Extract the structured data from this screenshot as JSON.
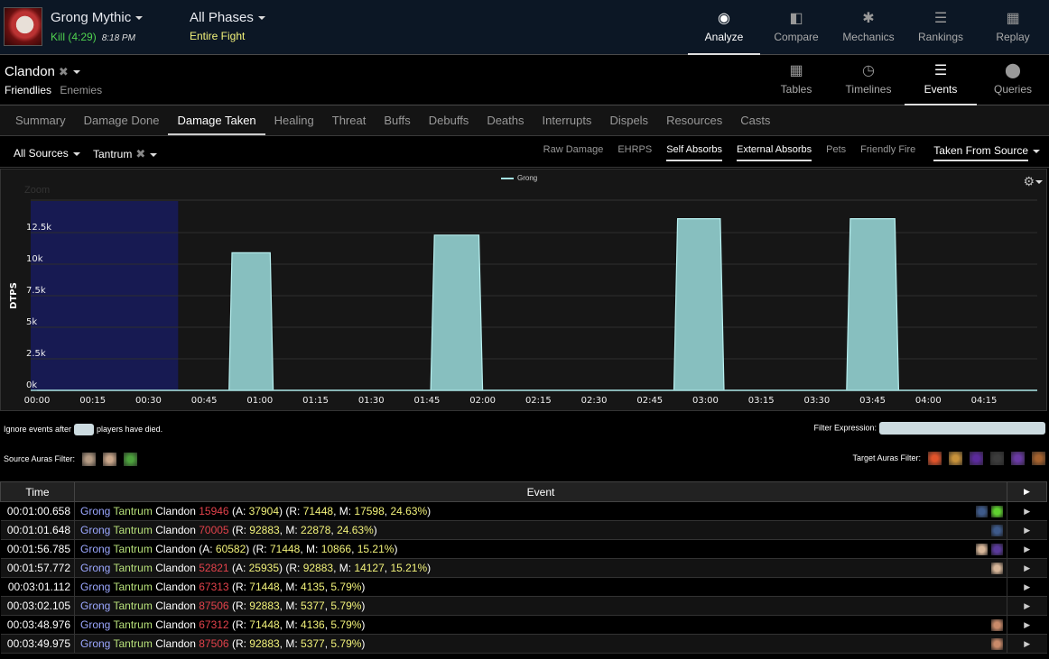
{
  "header": {
    "fight_name": "Grong Mythic",
    "kill_label": "Kill (4:29)",
    "fight_time": "8:18 PM",
    "phase_name": "All Phases",
    "phase_sub": "Entire Fight",
    "nav": [
      {
        "label": "Analyze",
        "icon": "eye-icon",
        "active": true
      },
      {
        "label": "Compare",
        "icon": "compare-icon",
        "active": false
      },
      {
        "label": "Mechanics",
        "icon": "puzzle-icon",
        "active": false
      },
      {
        "label": "Rankings",
        "icon": "sort-icon",
        "active": false
      },
      {
        "label": "Replay",
        "icon": "film-icon",
        "active": false
      }
    ]
  },
  "actor": {
    "name": "Clandon",
    "friendlies_label": "Friendlies",
    "enemies_label": "Enemies",
    "views": [
      {
        "label": "Tables",
        "icon": "grid-icon",
        "active": false
      },
      {
        "label": "Timelines",
        "icon": "clock-icon",
        "active": false
      },
      {
        "label": "Events",
        "icon": "list-icon",
        "active": true
      },
      {
        "label": "Queries",
        "icon": "map-pin-icon",
        "active": false
      }
    ]
  },
  "tabs": [
    {
      "label": "Summary",
      "active": false
    },
    {
      "label": "Damage Done",
      "active": false
    },
    {
      "label": "Damage Taken",
      "active": true
    },
    {
      "label": "Healing",
      "active": false
    },
    {
      "label": "Threat",
      "active": false
    },
    {
      "label": "Buffs",
      "active": false
    },
    {
      "label": "Debuffs",
      "active": false
    },
    {
      "label": "Deaths",
      "active": false
    },
    {
      "label": "Interrupts",
      "active": false
    },
    {
      "label": "Dispels",
      "active": false
    },
    {
      "label": "Resources",
      "active": false
    },
    {
      "label": "Casts",
      "active": false
    }
  ],
  "filters": {
    "source": "All Sources",
    "ability": "Tantrum",
    "options": [
      {
        "label": "Raw Damage",
        "on": false
      },
      {
        "label": "EHRPS",
        "on": false
      },
      {
        "label": "Self Absorbs",
        "on": true
      },
      {
        "label": "External Absorbs",
        "on": true
      },
      {
        "label": "Pets",
        "on": false
      },
      {
        "label": "Friendly Fire",
        "on": false
      }
    ],
    "taken_from": "Taken From Source"
  },
  "chart_data": {
    "type": "area",
    "title": "",
    "zoom_label": "Zoom",
    "ylabel": "DTPS",
    "xlabel": "",
    "legend": [
      "Grong"
    ],
    "legend_position": "top-center",
    "grid": true,
    "ylim": [
      0,
      15000
    ],
    "xlim_seconds": [
      0,
      265
    ],
    "yticks": [
      "0k",
      "2.5k",
      "5k",
      "7.5k",
      "10k",
      "12.5k"
    ],
    "ytick_values": [
      0,
      2500,
      5000,
      7500,
      10000,
      12500
    ],
    "xticks": [
      "00:00",
      "00:15",
      "00:30",
      "00:45",
      "01:00",
      "01:15",
      "01:30",
      "01:45",
      "02:00",
      "02:15",
      "02:30",
      "02:45",
      "03:00",
      "03:15",
      "03:30",
      "03:45",
      "04:00",
      "04:15"
    ],
    "zoom_region_seconds": [
      0,
      38
    ],
    "color": "#87bfbf",
    "series": [
      {
        "name": "Grong",
        "points_seconds_value": [
          [
            0,
            0
          ],
          [
            51.7,
            0
          ],
          [
            52.5,
            10900
          ],
          [
            62.8,
            10900
          ],
          [
            63.6,
            0
          ],
          [
            106,
            0
          ],
          [
            107,
            12300
          ],
          [
            119,
            12300
          ],
          [
            120,
            0
          ],
          [
            171.5,
            0
          ],
          [
            172.5,
            13600
          ],
          [
            184,
            13600
          ],
          [
            185,
            0
          ],
          [
            218,
            0
          ],
          [
            219,
            13600
          ],
          [
            231,
            13600
          ],
          [
            232,
            0
          ],
          [
            265,
            0
          ]
        ]
      }
    ]
  },
  "options_row": {
    "ignore_prefix": "Ignore events after",
    "ignore_suffix": "players have died.",
    "filter_expression_label": "Filter Expression:",
    "filter_expression_value": "",
    "source_auras_label": "Source Auras Filter:",
    "source_auras": [
      "#b49b84",
      "#c9a68a",
      "#4ca13c"
    ],
    "target_auras_label": "Target Auras Filter:",
    "target_auras": [
      "#e0532a",
      "#c8923a",
      "#5b2a9c",
      "#3c3c3c",
      "#6a3aa5",
      "#a5622e"
    ]
  },
  "events": {
    "columns": [
      "Time",
      "Event"
    ],
    "rows": [
      {
        "time": "00:01:00.658",
        "source": "Grong",
        "ability": "Tantrum",
        "target": "Clandon",
        "amount": "15946",
        "absorb": "37904",
        "r": "71448",
        "m": "17598",
        "pct": "24.63%",
        "icons": [
          "#3e5a8a",
          "#5fd12f"
        ]
      },
      {
        "time": "00:01:01.648",
        "source": "Grong",
        "ability": "Tantrum",
        "target": "Clandon",
        "amount": "70005",
        "absorb": null,
        "r": "92883",
        "m": "22878",
        "pct": "24.63%",
        "icons": [
          "#3e5a8a"
        ]
      },
      {
        "time": "00:01:56.785",
        "source": "Grong",
        "ability": "Tantrum",
        "target": "Clandon",
        "amount": null,
        "absorb": "60582",
        "r": "71448",
        "m": "10866",
        "pct": "15.21%",
        "icons": [
          "#d8b79a",
          "#5a3a9a"
        ]
      },
      {
        "time": "00:01:57.772",
        "source": "Grong",
        "ability": "Tantrum",
        "target": "Clandon",
        "amount": "52821",
        "absorb": "25935",
        "r": "92883",
        "m": "14127",
        "pct": "15.21%",
        "icons": [
          "#d8b79a"
        ]
      },
      {
        "time": "00:03:01.112",
        "source": "Grong",
        "ability": "Tantrum",
        "target": "Clandon",
        "amount": "67313",
        "absorb": null,
        "r": "71448",
        "m": "4135",
        "pct": "5.79%",
        "icons": []
      },
      {
        "time": "00:03:02.105",
        "source": "Grong",
        "ability": "Tantrum",
        "target": "Clandon",
        "amount": "87506",
        "absorb": null,
        "r": "92883",
        "m": "5377",
        "pct": "5.79%",
        "icons": []
      },
      {
        "time": "00:03:48.976",
        "source": "Grong",
        "ability": "Tantrum",
        "target": "Clandon",
        "amount": "67312",
        "absorb": null,
        "r": "71448",
        "m": "4136",
        "pct": "5.79%",
        "icons": [
          "#c98a6a"
        ]
      },
      {
        "time": "00:03:49.975",
        "source": "Grong",
        "ability": "Tantrum",
        "target": "Clandon",
        "amount": "87506",
        "absorb": null,
        "r": "92883",
        "m": "5377",
        "pct": "5.79%",
        "icons": [
          "#c98a6a"
        ]
      }
    ]
  }
}
